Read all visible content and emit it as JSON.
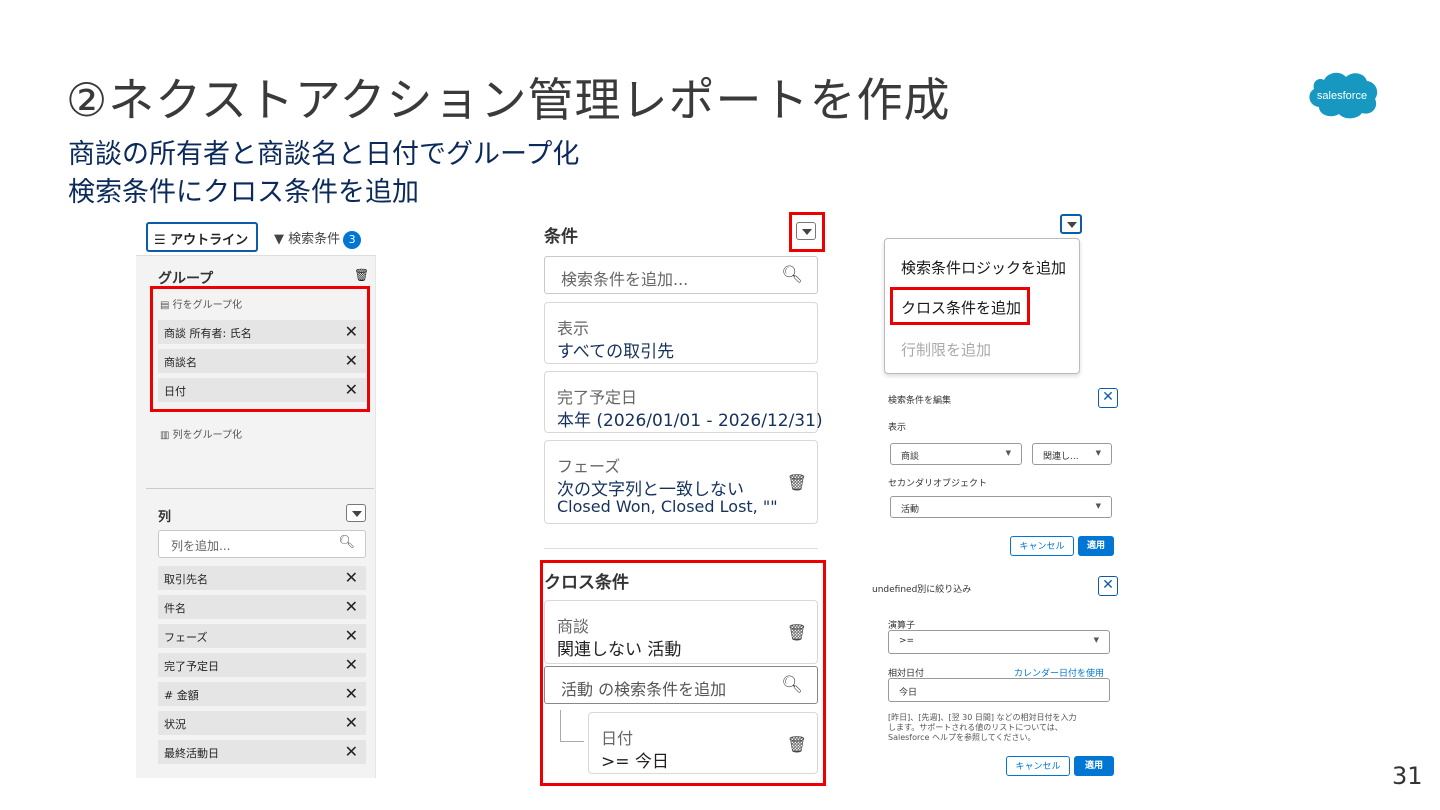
{
  "slide": {
    "title": "②ネクストアクション管理レポートを作成",
    "subtitle1": "商談の所有者と商談名と日付でグループ化",
    "subtitle2": "検索条件にクロス条件を追加",
    "logo_text": "salesforce",
    "page_number": "31"
  },
  "outline_panel": {
    "tab_outline": "☰ アウトライン",
    "tab_filter": "検索条件",
    "filter_count": "3",
    "group_heading": "グループ",
    "row_group_label": "行をグループ化",
    "row_groups": [
      "商談 所有者: 氏名",
      "商談名",
      "日付"
    ],
    "col_group_label": "列をグループ化",
    "columns_heading": "列",
    "columns_placeholder": "列を追加...",
    "columns": [
      "取引先名",
      "件名",
      "フェーズ",
      "完了予定日",
      "# 金額",
      "状況",
      "最終活動日"
    ]
  },
  "filter_panel": {
    "heading": "条件",
    "search_placeholder": "検索条件を追加...",
    "filters": [
      {
        "label": "表示",
        "value": "すべての取引先"
      },
      {
        "label": "完了予定日",
        "value": "本年 (2026/01/01 - 2026/12/31)"
      },
      {
        "label": "フェーズ",
        "value": "次の文字列と一致しない",
        "value2": "Closed Won, Closed Lost, \"\""
      }
    ],
    "cross_heading": "クロス条件",
    "cross_label": "商談",
    "cross_value": "関連しない 活動",
    "cross_search_placeholder": "活動 の検索条件を追加",
    "sub_filter_label": "日付",
    "sub_filter_value": ">= 今日"
  },
  "menu": {
    "items": [
      "検索条件ロジックを追加",
      "クロス条件を追加",
      "行制限を追加"
    ]
  },
  "edit_panel": {
    "title": "検索条件を編集",
    "show_label": "表示",
    "object_select": "商談",
    "relation_select": "関連し...",
    "secondary_label": "セカンダリオブジェクト",
    "secondary_select": "活動",
    "cancel": "キャンセル",
    "apply": "適用"
  },
  "narrow_panel": {
    "title": "undefined別に絞り込み",
    "operator_label": "演算子",
    "operator_value": ">=",
    "relative_label": "相対日付",
    "calendar_link": "カレンダー日付を使用",
    "relative_value": "今日",
    "help_text_1": "[昨日]、[先週]、[翌 30 日間] などの相対日付を入力",
    "help_text_2": "します。サポートされる値のリストについては、",
    "help_text_3": "Salesforce ヘルプを参照してください。",
    "cancel": "キャンセル",
    "apply": "適用"
  },
  "colors": {
    "accent": "#0176d3",
    "highlight": "#e00000"
  }
}
